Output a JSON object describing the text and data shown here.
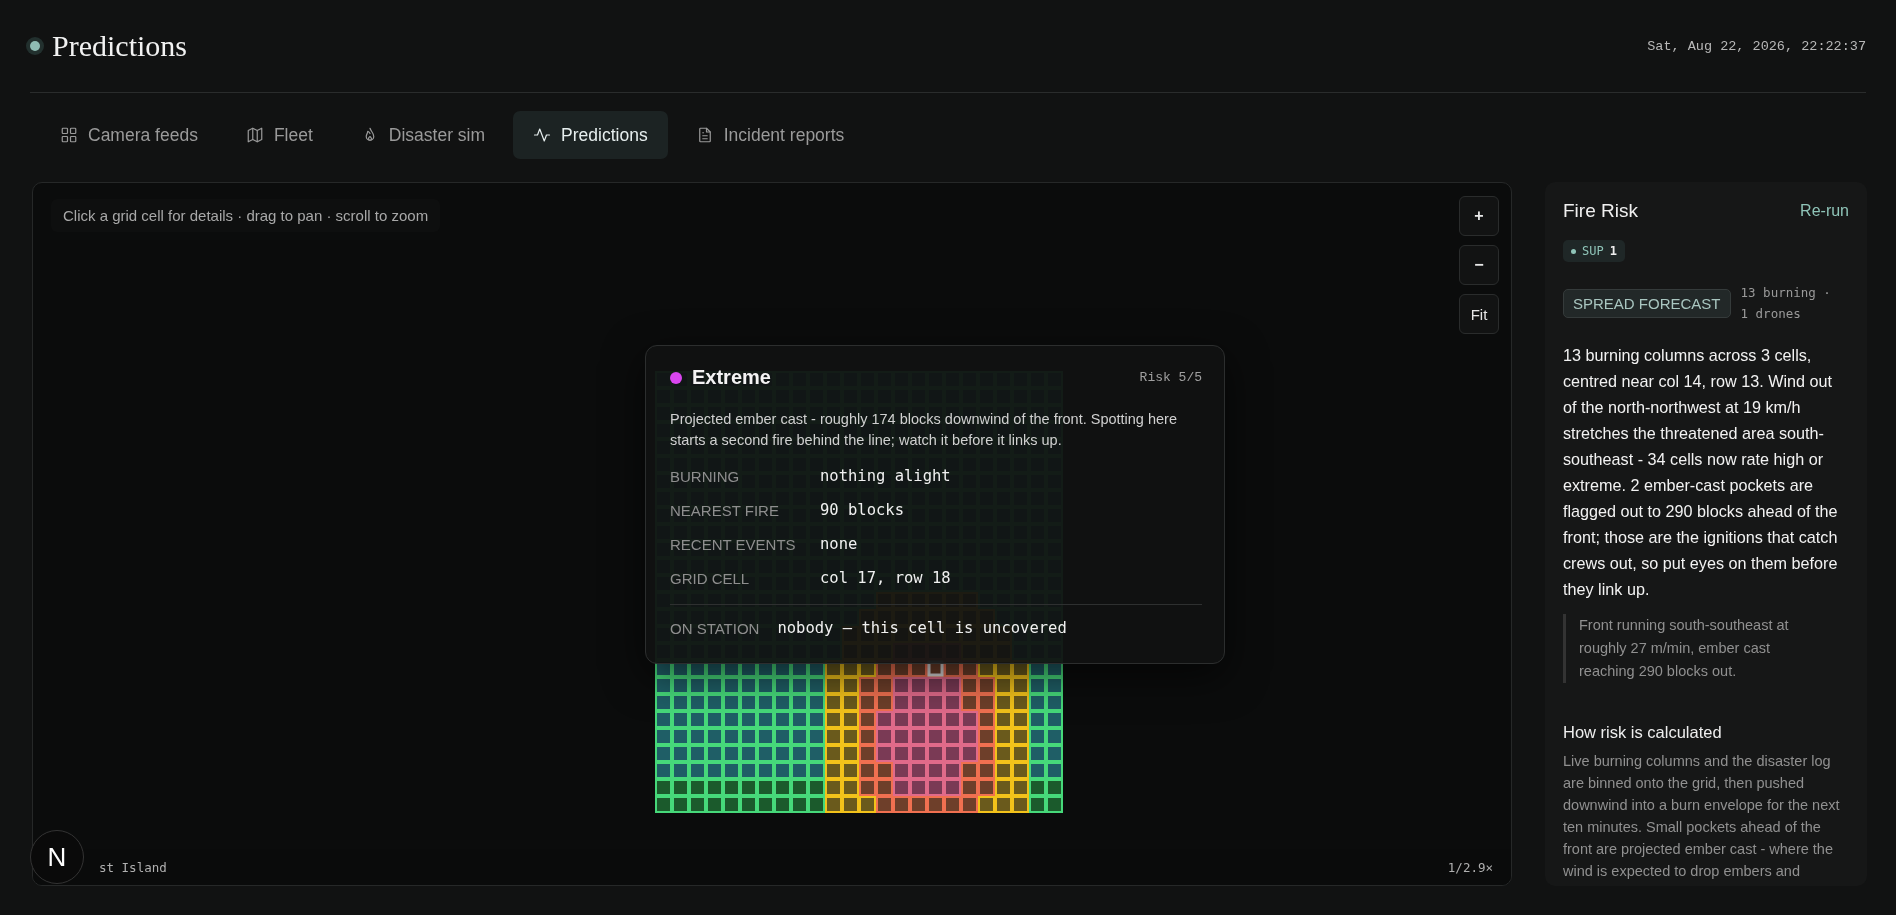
{
  "header": {
    "title": "Predictions",
    "datetime": "Sat, Aug 22, 2026, 22:22:37"
  },
  "tabs": [
    {
      "label": "Camera feeds",
      "selected": false
    },
    {
      "label": "Fleet",
      "selected": false
    },
    {
      "label": "Disaster sim",
      "selected": false
    },
    {
      "label": "Predictions",
      "selected": true
    },
    {
      "label": "Incident reports",
      "selected": false
    }
  ],
  "map": {
    "hint": "Click a grid cell for details · drag to pan · scroll to zoom",
    "controls": [
      "+",
      "−",
      "Fit"
    ],
    "location_label": "st Island",
    "zoom_label": "1/2.9×"
  },
  "tooltip": {
    "level": "Extreme",
    "color": "#d946ef",
    "risk": "Risk 5/5",
    "description": "Projected ember cast - roughly 174 blocks downwind of the front. Spotting here starts a second fire behind the line; watch it before it links up.",
    "fields": [
      {
        "label": "BURNING",
        "value": "nothing alight"
      },
      {
        "label": "NEAREST FIRE",
        "value": "90 blocks"
      },
      {
        "label": "RECENT EVENTS",
        "value": "none"
      },
      {
        "label": "GRID CELL",
        "value": "col 17, row 18"
      }
    ],
    "station": {
      "label": "ON STATION",
      "value": "nobody — this cell is uncovered"
    }
  },
  "panel": {
    "title": "Fire Risk",
    "action": "Re-run",
    "badge": {
      "label": "SUP",
      "value": "1"
    },
    "tag": "SPREAD FORECAST",
    "stats": "13 burning · 1 drones",
    "summary": "13 burning columns across 3 cells, centred near col 14, row 13. Wind out of the north-northwest at 19 km/h stretches the threatened area south-southeast - 34 cells now rate high or extreme. 2 ember-cast pockets are flagged out to 290 blocks ahead of the front; those are the ignitions that catch crews out, so put eyes on them before they link up.",
    "quote": "Front running south-southeast at roughly 27 m/min, ember cast reaching 290 blocks out.",
    "section_title": "How risk is calculated",
    "section_text": "Live burning columns and the disaster log are binned onto the grid, then pushed downwind into a burn envelope for the next ten minutes. Small pockets ahead of the front are projected ember cast - where the wind is expected to drop embers and"
  },
  "dev_badge": "N"
}
